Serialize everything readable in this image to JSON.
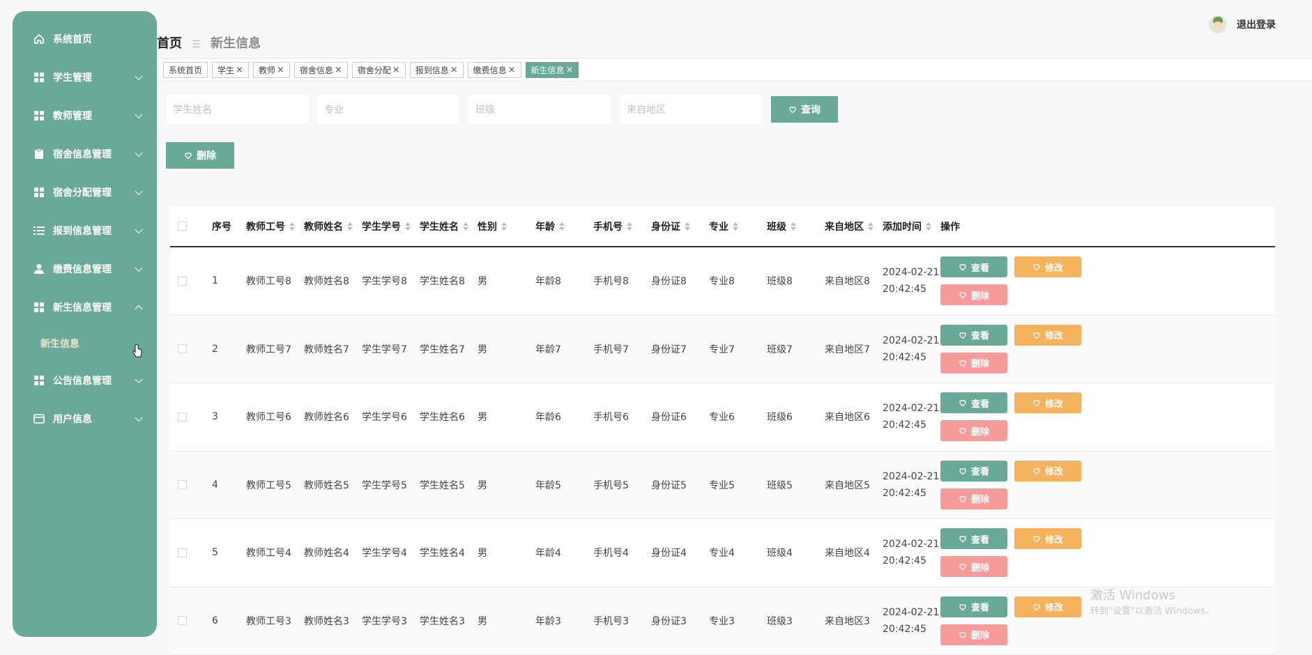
{
  "sidebar": {
    "items": [
      {
        "label": "系统首页",
        "icon": "home-icon",
        "expand": false
      },
      {
        "label": "学生管理",
        "icon": "grid-icon",
        "expand": true
      },
      {
        "label": "教师管理",
        "icon": "grid-icon",
        "expand": true
      },
      {
        "label": "宿舍信息管理",
        "icon": "clipboard-icon",
        "expand": true
      },
      {
        "label": "宿舍分配管理",
        "icon": "grid-icon",
        "expand": true
      },
      {
        "label": "报到信息管理",
        "icon": "list-icon",
        "expand": true
      },
      {
        "label": "缴费信息管理",
        "icon": "user-icon",
        "expand": true
      },
      {
        "label": "新生信息管理",
        "icon": "grid-icon",
        "expand": true,
        "open": true
      },
      {
        "label": "公告信息管理",
        "icon": "grid-icon",
        "expand": true
      },
      {
        "label": "用户信息",
        "icon": "card-icon",
        "expand": true
      }
    ],
    "sub_item": "新生信息"
  },
  "header": {
    "breadcrumb_home": "首页",
    "breadcrumb_sep": "☰",
    "breadcrumb_current": "新生信息",
    "logout": "退出登录"
  },
  "tags": [
    {
      "label": "系统首页",
      "closable": false
    },
    {
      "label": "学生",
      "closable": true
    },
    {
      "label": "教师",
      "closable": true
    },
    {
      "label": "宿舍信息",
      "closable": true
    },
    {
      "label": "宿舍分配",
      "closable": true
    },
    {
      "label": "报到信息",
      "closable": true
    },
    {
      "label": "缴费信息",
      "closable": true
    },
    {
      "label": "新生信息",
      "closable": true,
      "active": true
    }
  ],
  "search": {
    "placeholders": [
      "学生姓名",
      "专业",
      "班级",
      "来自地区"
    ],
    "query_label": "查询"
  },
  "actions": {
    "delete_label": "删除"
  },
  "table": {
    "columns": [
      "序号",
      "教师工号",
      "教师姓名",
      "学生学号",
      "学生姓名",
      "性别",
      "年龄",
      "手机号",
      "身份证",
      "专业",
      "班级",
      "来自地区",
      "添加时间",
      "操作"
    ],
    "rows": [
      [
        "1",
        "教师工号8",
        "教师姓名8",
        "学生学号8",
        "学生姓名8",
        "男",
        "年龄8",
        "手机号8",
        "身份证8",
        "专业8",
        "班级8",
        "来自地区8",
        "2024-02-21",
        "20:42:45"
      ],
      [
        "2",
        "教师工号7",
        "教师姓名7",
        "学生学号7",
        "学生姓名7",
        "男",
        "年龄7",
        "手机号7",
        "身份证7",
        "专业7",
        "班级7",
        "来自地区7",
        "2024-02-21",
        "20:42:45"
      ],
      [
        "3",
        "教师工号6",
        "教师姓名6",
        "学生学号6",
        "学生姓名6",
        "男",
        "年龄6",
        "手机号6",
        "身份证6",
        "专业6",
        "班级6",
        "来自地区6",
        "2024-02-21",
        "20:42:45"
      ],
      [
        "4",
        "教师工号5",
        "教师姓名5",
        "学生学号5",
        "学生姓名5",
        "男",
        "年龄5",
        "手机号5",
        "身份证5",
        "专业5",
        "班级5",
        "来自地区5",
        "2024-02-21",
        "20:42:45"
      ],
      [
        "5",
        "教师工号4",
        "教师姓名4",
        "学生学号4",
        "学生姓名4",
        "男",
        "年龄4",
        "手机号4",
        "身份证4",
        "专业4",
        "班级4",
        "来自地区4",
        "2024-02-21",
        "20:42:45"
      ],
      [
        "6",
        "教师工号3",
        "教师姓名3",
        "学生学号3",
        "学生姓名3",
        "男",
        "年龄3",
        "手机号3",
        "身份证3",
        "专业3",
        "班级3",
        "来自地区3",
        "2024-02-21",
        "20:42:45"
      ]
    ],
    "op_view": "查看",
    "op_edit": "修改",
    "op_delete": "删除"
  },
  "watermark": {
    "line1": "激活 Windows",
    "line2": "转到\"设置\"以激活 Windows。"
  },
  "colors": {
    "primary": "#6aa99a",
    "edit": "#f5b25c",
    "delete": "#f79a9a"
  }
}
